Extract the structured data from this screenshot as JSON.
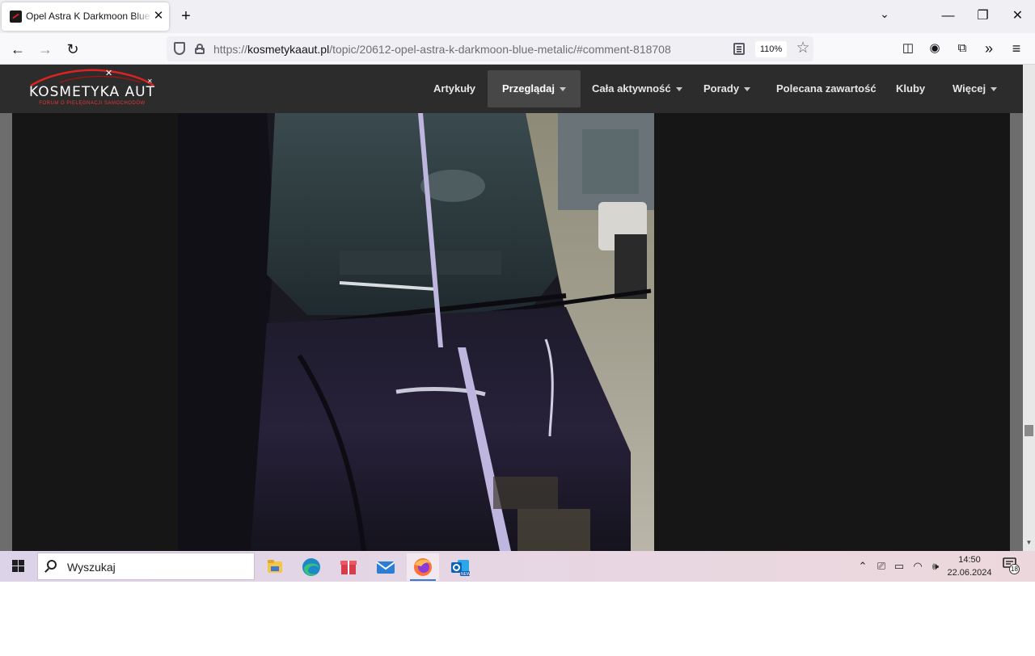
{
  "browser": {
    "tab": {
      "title": "Opel Astra K Darkmoon Blue Metalic",
      "close_glyph": "✕"
    },
    "new_tab_glyph": "+",
    "tab_list_glyph": "⌄",
    "window_controls": {
      "minimize": "—",
      "restore": "❐",
      "close": "✕"
    },
    "nav": {
      "back": "←",
      "forward": "→",
      "reload": "↻"
    },
    "url": {
      "scheme": "https://",
      "host": "kosmetykaaut.pl",
      "path": "/topic/20612-opel-astra-k-darkmoon-blue-metalic/#comment-818708"
    },
    "zoom_label": "110%",
    "bookmark_glyph": "☆",
    "toolbar": {
      "pocket": "◫",
      "account": "◉",
      "extensions": "⧉",
      "overflow": "»",
      "menu": "≡"
    }
  },
  "site": {
    "logo": {
      "title": "KOSMETYKA AUT",
      "subtitle": "FORUM O PIELĘGNACJI SAMOCHODÓW"
    },
    "nav": [
      {
        "label": "Artykuły",
        "dropdown": false
      },
      {
        "label": "Przeglądaj",
        "dropdown": true,
        "active": true
      },
      {
        "label": "Cała aktywność",
        "dropdown": true
      },
      {
        "label": "Porady",
        "dropdown": true
      },
      {
        "label": "Polecana zawartość",
        "dropdown": false
      },
      {
        "label": "Kluby",
        "dropdown": false
      },
      {
        "label": "Więcej",
        "dropdown": true
      }
    ],
    "scroll_down_glyph": "▼"
  },
  "taskbar": {
    "search_placeholder": "Wyszukaj",
    "apps": [
      "file-explorer",
      "edge",
      "gift-app",
      "mail",
      "firefox",
      "outlook-new"
    ],
    "clock": {
      "time": "14:50",
      "date": "22.06.2024"
    },
    "notification_count": "18",
    "tray": {
      "chevron": "⌃",
      "meet": "⎚",
      "battery": "▭",
      "wifi": "◠",
      "volume": "🕪"
    }
  },
  "colors": {
    "site_header": "#2c2c2c",
    "site_nav_active": "#474747",
    "logo_accent": "#dd2222",
    "content_bg": "#161616",
    "firefox_active_indicator": "#3b78d8"
  }
}
